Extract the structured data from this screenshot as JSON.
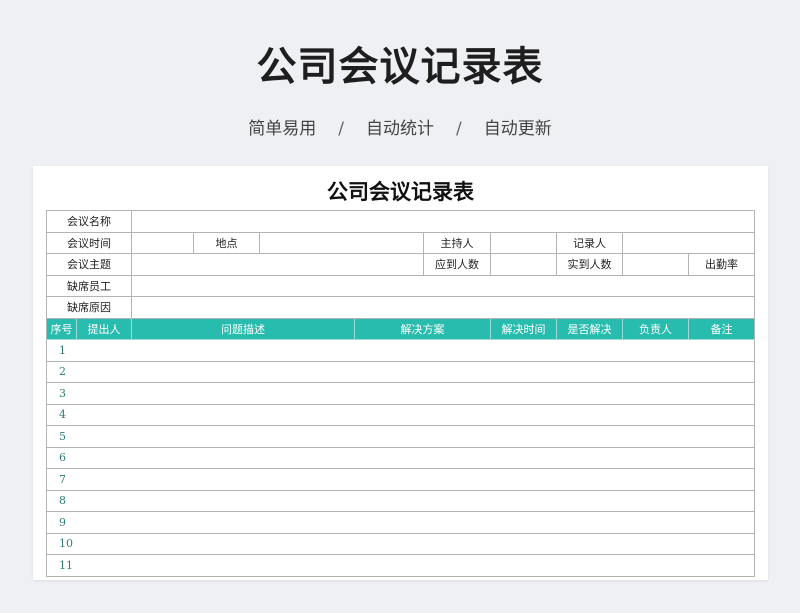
{
  "page": {
    "title": "公司会议记录表",
    "subtitle_items": [
      "简单易用",
      "自动统计",
      "自动更新"
    ],
    "separator": "/"
  },
  "sheet": {
    "title": "公司会议记录表",
    "info": {
      "meeting_name_label": "会议名称",
      "meeting_time_label": "会议时间",
      "location_label": "地点",
      "host_label": "主持人",
      "recorder_label": "记录人",
      "topic_label": "会议主题",
      "expected_label": "应到人数",
      "actual_label": "实到人数",
      "attendance_label": "出勤率",
      "absent_label": "缺席员工",
      "absent_reason_label": "缺席原因"
    },
    "columns": [
      "序号",
      "提出人",
      "问题描述",
      "解决方案",
      "解决时间",
      "是否解决",
      "负责人",
      "备注"
    ],
    "rows": [
      "1",
      "2",
      "3",
      "4",
      "5",
      "6",
      "7",
      "8",
      "9",
      "10",
      "11"
    ]
  },
  "colors": {
    "header_bg": "#27bcae",
    "header_text": "#ffffff",
    "page_bg": "#eef0f3",
    "row_number": "#2e7d74"
  }
}
